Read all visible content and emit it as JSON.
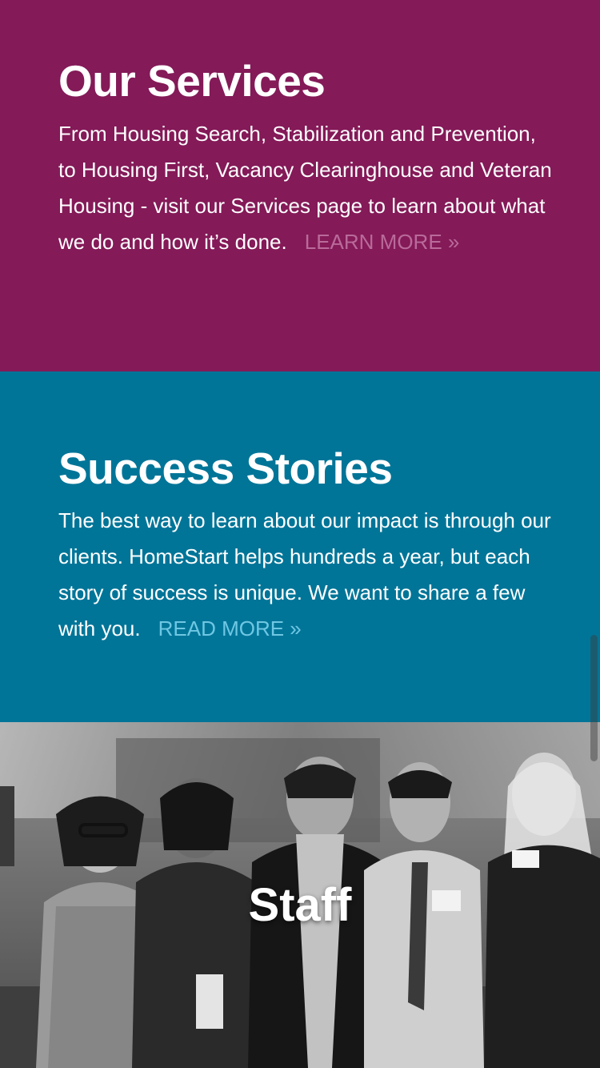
{
  "services": {
    "title": "Our Services",
    "body": "From Housing Search, Stabilization and Prevention, to Housing First, Vacancy Clearinghouse and Veteran Housing - visit our Services page to learn about what we do and how it’s done.",
    "link_label": "LEARN MORE »",
    "background_color": "#841a58"
  },
  "stories": {
    "title": "Success Stories",
    "body": "The best way to learn about our impact is through our clients. HomeStart helps hundreds a year, but each story of success is unique. We want to share a few with you.",
    "link_label": "READ MORE »",
    "background_color": "#017598"
  },
  "staff": {
    "title": "Staff",
    "photo": "black-and-white group photo of five staff members"
  }
}
